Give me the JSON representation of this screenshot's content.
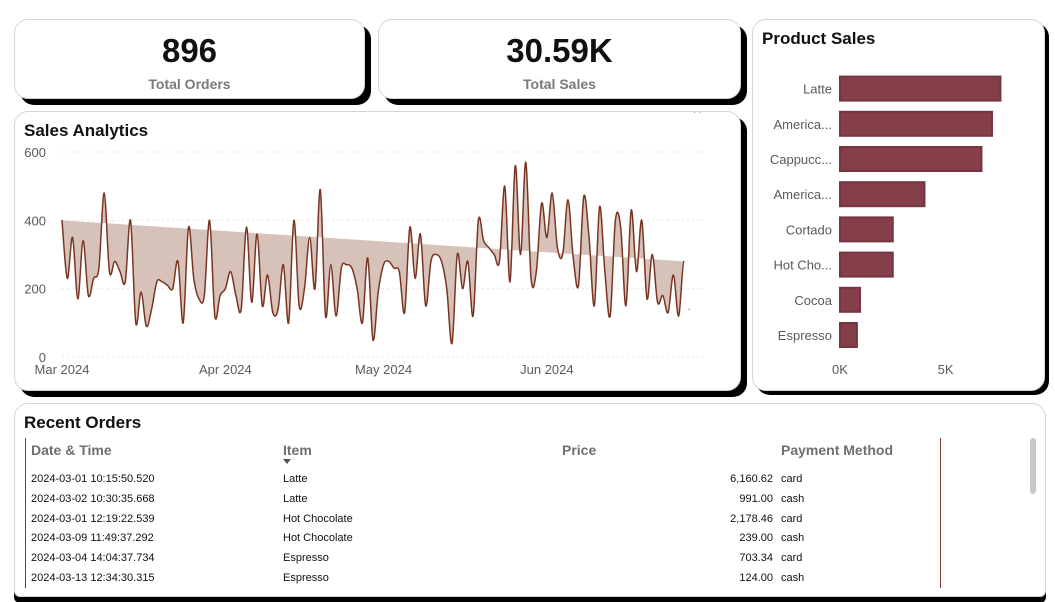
{
  "kpis": {
    "orders": {
      "value": "896",
      "label": "Total Orders"
    },
    "sales": {
      "value": "30.59K",
      "label": "Total Sales"
    }
  },
  "product_sales": {
    "title": "Product Sales",
    "color": "#7b2f3a"
  },
  "sales_analytics": {
    "title": "Sales Analytics",
    "line_color": "#7a3522",
    "fill_color": "#d7c2b9"
  },
  "recent_orders": {
    "title": "Recent Orders",
    "columns": [
      "Date & Time",
      "Item",
      "Price",
      "Payment Method"
    ],
    "rows": [
      [
        "2024-03-01 10:15:50.520",
        "Latte",
        "6,160.62",
        "card"
      ],
      [
        "2024-03-02 10:30:35.668",
        "Latte",
        "991.00",
        "cash"
      ],
      [
        "2024-03-01 12:19:22.539",
        "Hot Chocolate",
        "2,178.46",
        "card"
      ],
      [
        "2024-03-09 11:49:37.292",
        "Hot Chocolate",
        "239.00",
        "cash"
      ],
      [
        "2024-03-04 14:04:37.734",
        "Espresso",
        "703.34",
        "card"
      ],
      [
        "2024-03-13 12:34:30.315",
        "Espresso",
        "124.00",
        "cash"
      ]
    ]
  },
  "chart_data": [
    {
      "type": "bar",
      "title": "Product Sales",
      "orientation": "horizontal",
      "categories": [
        "Latte",
        "America...",
        "Cappucc...",
        "America...",
        "Cortado",
        "Hot Cho...",
        "Cocoa",
        "Espresso"
      ],
      "values": [
        7600,
        7200,
        6700,
        4000,
        2500,
        2500,
        950,
        800
      ],
      "x_ticks": [
        "0K",
        "5K"
      ],
      "xlim": [
        0,
        9000
      ],
      "grid": false
    },
    {
      "type": "area",
      "title": "Sales Analytics",
      "ylim": [
        0,
        600
      ],
      "y_ticks": [
        0,
        200,
        400,
        600
      ],
      "x_ticks": [
        "Mar 2024",
        "Apr 2024",
        "May 2024",
        "Jun 2024"
      ],
      "x_tick_dates": [
        "2024-03-01",
        "2024-04-01",
        "2024-05-01",
        "2024-06-01"
      ],
      "x_range": [
        "2024-03-01",
        "2024-07-01"
      ],
      "grid": true,
      "x": [
        "2024-03-01",
        "2024-03-02",
        "2024-03-03",
        "2024-03-04",
        "2024-03-05",
        "2024-03-06",
        "2024-03-07",
        "2024-03-08",
        "2024-03-09",
        "2024-03-10",
        "2024-03-11",
        "2024-03-12",
        "2024-03-13",
        "2024-03-14",
        "2024-03-15",
        "2024-03-16",
        "2024-03-17",
        "2024-03-18",
        "2024-03-19",
        "2024-03-20",
        "2024-03-21",
        "2024-03-22",
        "2024-03-23",
        "2024-03-24",
        "2024-03-25",
        "2024-03-26",
        "2024-03-27",
        "2024-03-28",
        "2024-03-29",
        "2024-03-30",
        "2024-03-31",
        "2024-04-01",
        "2024-04-02",
        "2024-04-03",
        "2024-04-04",
        "2024-04-05",
        "2024-04-06",
        "2024-04-07",
        "2024-04-08",
        "2024-04-09",
        "2024-04-10",
        "2024-04-11",
        "2024-04-12",
        "2024-04-13",
        "2024-04-14",
        "2024-04-15",
        "2024-04-16",
        "2024-04-17",
        "2024-04-18",
        "2024-04-19",
        "2024-04-20",
        "2024-04-21",
        "2024-04-22",
        "2024-04-23",
        "2024-04-24",
        "2024-04-25",
        "2024-04-26",
        "2024-04-27",
        "2024-04-28",
        "2024-04-29",
        "2024-04-30",
        "2024-05-01",
        "2024-05-02",
        "2024-05-03",
        "2024-05-04",
        "2024-05-05",
        "2024-05-06",
        "2024-05-07",
        "2024-05-08",
        "2024-05-09",
        "2024-05-10",
        "2024-05-11",
        "2024-05-12",
        "2024-05-13",
        "2024-05-14",
        "2024-05-15",
        "2024-05-16",
        "2024-05-17",
        "2024-05-18",
        "2024-05-19",
        "2024-05-20",
        "2024-05-21",
        "2024-05-22",
        "2024-05-23",
        "2024-05-24",
        "2024-05-25",
        "2024-05-26",
        "2024-05-27",
        "2024-05-28",
        "2024-05-29",
        "2024-05-30",
        "2024-05-31",
        "2024-06-01",
        "2024-06-02",
        "2024-06-03",
        "2024-06-04",
        "2024-06-05",
        "2024-06-06",
        "2024-06-07",
        "2024-06-08",
        "2024-06-09",
        "2024-06-10",
        "2024-06-11",
        "2024-06-12",
        "2024-06-13",
        "2024-06-14",
        "2024-06-15",
        "2024-06-16",
        "2024-06-17",
        "2024-06-18",
        "2024-06-19",
        "2024-06-20",
        "2024-06-21",
        "2024-06-22",
        "2024-06-23",
        "2024-06-24",
        "2024-06-25",
        "2024-06-26",
        "2024-06-27",
        "2024-06-28",
        "2024-06-29",
        "2024-06-30"
      ],
      "values": [
        400,
        230,
        350,
        170,
        340,
        180,
        230,
        260,
        480,
        250,
        280,
        250,
        220,
        400,
        100,
        190,
        90,
        140,
        220,
        220,
        210,
        200,
        280,
        100,
        380,
        230,
        170,
        180,
        400,
        120,
        180,
        200,
        250,
        180,
        140,
        380,
        160,
        360,
        150,
        240,
        130,
        140,
        270,
        100,
        400,
        150,
        200,
        350,
        200,
        490,
        120,
        270,
        120,
        260,
        270,
        260,
        200,
        100,
        290,
        50,
        190,
        270,
        280,
        260,
        250,
        130,
        380,
        230,
        360,
        150,
        280,
        300,
        280,
        200,
        40,
        300,
        200,
        280,
        120,
        400,
        340,
        320,
        300,
        280,
        500,
        220,
        560,
        300,
        570,
        230,
        250,
        450,
        350,
        480,
        320,
        300,
        460,
        290,
        210,
        470,
        350,
        150,
        440,
        250,
        120,
        400,
        380,
        150,
        430,
        250,
        400,
        170,
        300,
        160,
        180,
        130,
        240,
        120,
        280,
        140
      ]
    }
  ]
}
